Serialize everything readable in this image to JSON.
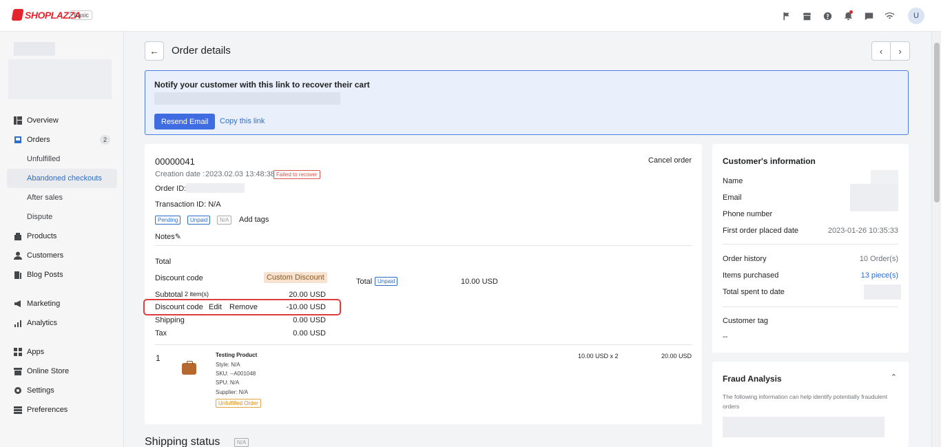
{
  "topbar": {
    "brand": "SHOPLAZZA",
    "plan": "Basic",
    "icons": [
      "flag-icon",
      "store-icon",
      "help-icon",
      "bell-icon",
      "chat-icon",
      "wifi-icon"
    ],
    "avatar_initial": "U"
  },
  "sidebar": {
    "items": [
      {
        "label": "Overview",
        "icon": "overview-icon"
      },
      {
        "label": "Orders",
        "icon": "orders-icon",
        "count": "2"
      },
      {
        "label": "Unfulfilled"
      },
      {
        "label": "Abandoned checkouts"
      },
      {
        "label": "After sales"
      },
      {
        "label": "Dispute"
      },
      {
        "label": "Products",
        "icon": "products-icon"
      },
      {
        "label": "Customers",
        "icon": "customers-icon"
      },
      {
        "label": "Blog Posts",
        "icon": "blog-icon"
      },
      {
        "label": "Marketing",
        "icon": "marketing-icon"
      },
      {
        "label": "Analytics",
        "icon": "analytics-icon"
      },
      {
        "label": "Apps",
        "icon": "apps-icon"
      },
      {
        "label": "Online Store",
        "icon": "online-store-icon"
      },
      {
        "label": "Settings",
        "icon": "settings-icon"
      },
      {
        "label": "Preferences",
        "icon": "preferences-icon"
      }
    ]
  },
  "header": {
    "title": "Order details"
  },
  "notice": {
    "title": "Notify your customer with this link to recover their cart",
    "resend_label": "Resend Email",
    "copy_label": "Copy this link"
  },
  "order": {
    "number": "00000041",
    "creation_label": "Creation date :",
    "creation_date": "2023.02.03 13:48:38",
    "status": "Failed to recover",
    "order_id_label": "Order ID:",
    "transaction_label": "Transaction ID: N/A",
    "tags": [
      "Pending",
      "Unpaid",
      "N/A"
    ],
    "add_tags": "Add tags",
    "notes": "Notes",
    "cancel": "Cancel order",
    "total_heading": "Total",
    "discount_code_label": "Discount code",
    "custom_discount": "Custom Discount",
    "subtotal_label": "Subtotal",
    "subtotal_items": "2 item(s)",
    "subtotal_value": "20.00 USD",
    "discount_label": "Discount code",
    "edit": "Edit",
    "remove": "Remove",
    "discount_value": "-10.00 USD",
    "shipping_label": "Shipping",
    "shipping_value": "0.00 USD",
    "tax_label": "Tax",
    "tax_value": "0.00 USD",
    "total_label": "Total",
    "total_badge": "Unpaid",
    "total_value": "10.00 USD"
  },
  "product": {
    "index": "1",
    "name": "Testing Product",
    "style": "Style: N/A",
    "sku": "SKU: --A001048",
    "spu": "SPU: N/A",
    "supplier": "Supplier: N/A",
    "status": "Unfulfilled Order",
    "price_qty": "10.00 USD x 2",
    "line_total": "20.00 USD"
  },
  "customer": {
    "title": "Customer's information",
    "name_label": "Name",
    "email_label": "Email",
    "phone_label": "Phone number",
    "first_order_label": "First order placed date",
    "first_order_value": "2023-01-26 10:35:33",
    "history_label": "Order history",
    "history_value": "10 Order(s)",
    "items_label": "Items purchased",
    "items_value": "13 piece(s)",
    "spent_label": "Total spent to date",
    "tag_label": "Customer tag",
    "tag_value": "--"
  },
  "fraud": {
    "title": "Fraud Analysis",
    "description": "The following information can help identify potentially fraudulent orders"
  },
  "shipping": {
    "title": "Shipping status",
    "badge": "N/A"
  }
}
